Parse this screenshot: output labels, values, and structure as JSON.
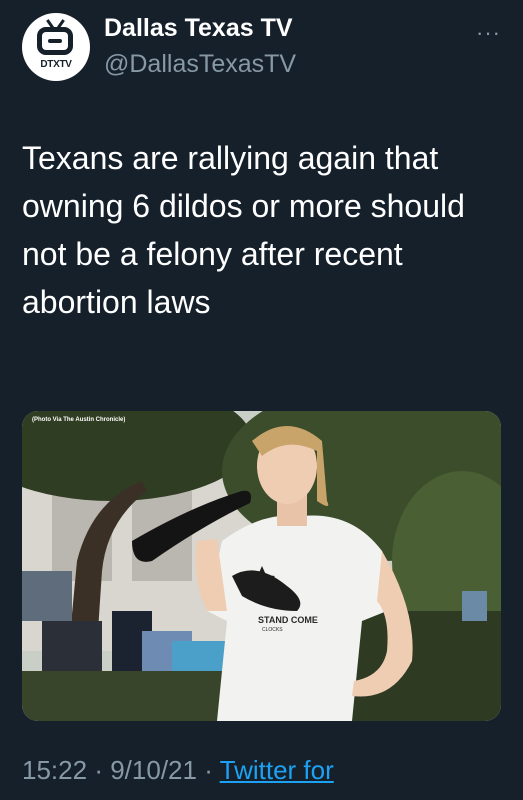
{
  "account": {
    "display_name": "Dallas Texas TV",
    "handle": "@DallasTexasTV",
    "avatar_text": "DTXTV"
  },
  "more_icon": "more-dots-icon",
  "tweet": {
    "text": "Texans are rallying again that owning 6 dildos or more should not be a felony after recent abortion laws"
  },
  "photo": {
    "credit": "(Photo Via The Austin Chronicle)",
    "shirt_text": "STAND COME",
    "shirt_text_small": "CLOCKS"
  },
  "footer": {
    "time": "15:22",
    "separator": "·",
    "date": "9/10/21",
    "source": "Twitter for"
  }
}
